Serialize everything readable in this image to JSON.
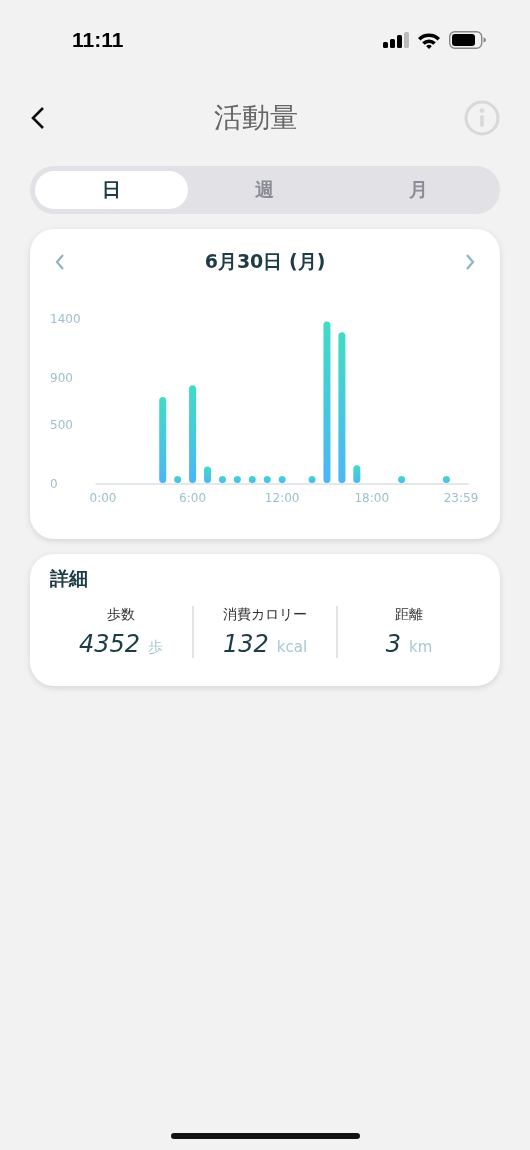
{
  "status_bar": {
    "time": "11:11"
  },
  "header": {
    "title": "活動量"
  },
  "tabs": [
    {
      "label": "日",
      "selected": true
    },
    {
      "label": "週",
      "selected": false
    },
    {
      "label": "月",
      "selected": false
    }
  ],
  "chart_card": {
    "date": "6月30日 (月)",
    "chart_data": {
      "type": "bar",
      "x": [
        4,
        5,
        6,
        7,
        8,
        9,
        10,
        11,
        12,
        14,
        15,
        16,
        17,
        20,
        23
      ],
      "series": [
        {
          "color": "#40dcc4",
          "values": [
            730,
            60,
            830,
            140,
            60,
            60,
            60,
            60,
            60,
            60,
            1370,
            1280,
            150,
            60,
            60
          ]
        }
      ],
      "xlim": [
        -0.5,
        24.5
      ],
      "ylim": [
        0,
        1400
      ],
      "yticks": [
        0,
        500,
        900,
        1400
      ],
      "xticks": [
        {
          "value": 0,
          "label": "0:00"
        },
        {
          "value": 6,
          "label": "6:00"
        },
        {
          "value": 12,
          "label": "12:00"
        },
        {
          "value": 18,
          "label": "18:00"
        },
        {
          "value": 23.98,
          "label": "23:59"
        }
      ]
    }
  },
  "details": {
    "title": "詳細",
    "stats": [
      {
        "label": "歩数",
        "value": "4352",
        "unit": "歩"
      },
      {
        "label": "消費カロリー",
        "value": "132",
        "unit": "kcal"
      },
      {
        "label": "距離",
        "value": "3",
        "unit": "km"
      }
    ]
  }
}
